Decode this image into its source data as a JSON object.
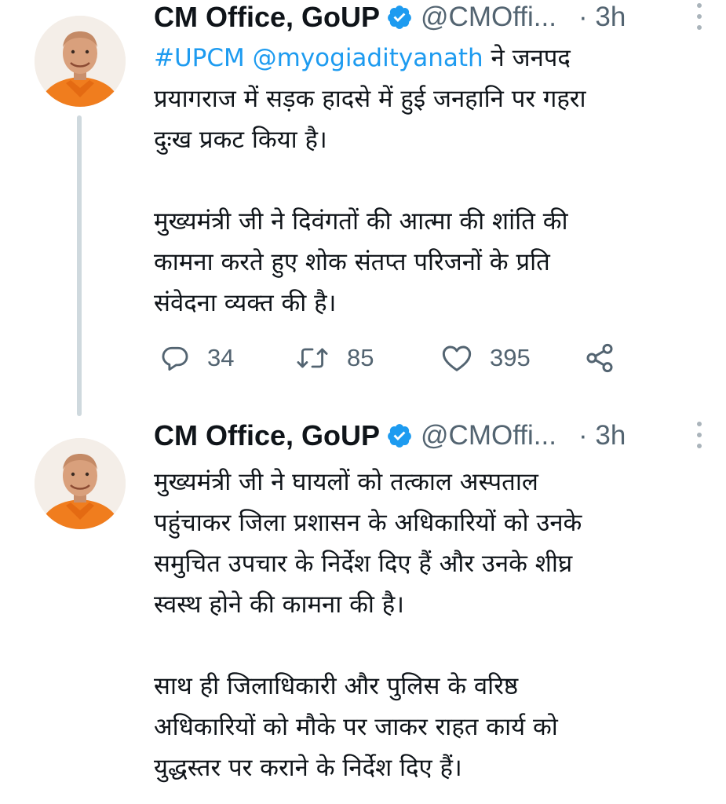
{
  "tweets": [
    {
      "author": {
        "name": "CM Office, GoUP",
        "handle": "@CMOffi...",
        "time": "· 3h",
        "verified": true
      },
      "text": {
        "hashtag": "#UPCM",
        "mention": "@myogiadityanath",
        "line1_rest": " ने जनपद",
        "line2": "प्रयागराज में सड़क हादसे में हुई जनहानि पर गहरा",
        "line3": "दुःख प्रकट किया है।",
        "line4": "मुख्यमंत्री जी ने दिवंगतों की आत्मा की शांति की",
        "line5": "कामना करते हुए शोक संतप्त परिजनों के प्रति",
        "line6": "संवेदना व्यक्त की है।"
      },
      "actions": {
        "replies": "34",
        "retweets": "85",
        "likes": "395"
      }
    },
    {
      "author": {
        "name": "CM Office, GoUP",
        "handle": "@CMOffi...",
        "time": "· 3h",
        "verified": true
      },
      "text": {
        "line1": "मुख्यमंत्री जी ने घायलों को तत्काल अस्पताल",
        "line2": "पहुंचाकर जिला प्रशासन के अधिकारियों को उनके",
        "line3": "समुचित उपचार के निर्देश दिए हैं और उनके शीघ्र",
        "line4": "स्वस्थ होने की कामना की है।",
        "line5": "साथ ही जिलाधिकारी और पुलिस के वरिष्ठ",
        "line6": "अधिकारियों को मौके पर जाकर राहत कार्य को",
        "line7": "युद्धस्तर पर कराने के निर्देश दिए हैं।"
      }
    }
  ],
  "icons": {
    "reply": "reply-icon",
    "retweet": "retweet-icon",
    "like": "heart-icon",
    "share": "share-icon",
    "verified": "verified-badge-icon",
    "more": "more-options-icon"
  },
  "colors": {
    "link": "#1d9bf0",
    "text": "#0f1419",
    "secondary": "#536471",
    "thread_line": "#cfd9de",
    "saffron": "#f07d1e"
  }
}
